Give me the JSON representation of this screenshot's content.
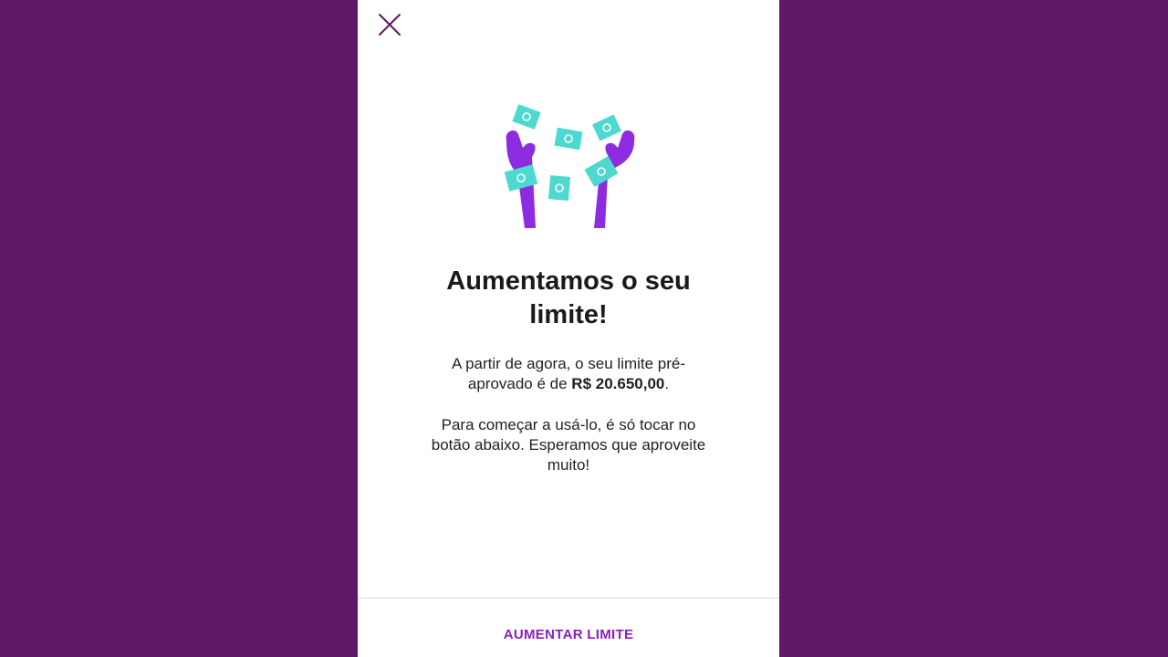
{
  "colors": {
    "background": "#5f1767",
    "card": "#ffffff",
    "accent": "#8a1fbf",
    "illustration_hands": "#8d2be0",
    "illustration_bills": "#4dd9cf"
  },
  "header": {
    "close_icon": "close-icon"
  },
  "illustration": {
    "icon": "hands-throwing-money-illustration"
  },
  "title": {
    "line1": "Aumentamos o seu",
    "line2": "limite!"
  },
  "paragraph1": {
    "line1": "A partir de agora, o seu limite pré-",
    "line2_prefix": "aprovado é de ",
    "amount": "R$ 20.650,00",
    "line2_suffix": "."
  },
  "paragraph2": {
    "line1": "Para começar a usá-lo, é só tocar no",
    "line2": "botão abaixo. Esperamos que aproveite",
    "line3": "muito!"
  },
  "footer": {
    "button_label": "AUMENTAR LIMITE"
  }
}
